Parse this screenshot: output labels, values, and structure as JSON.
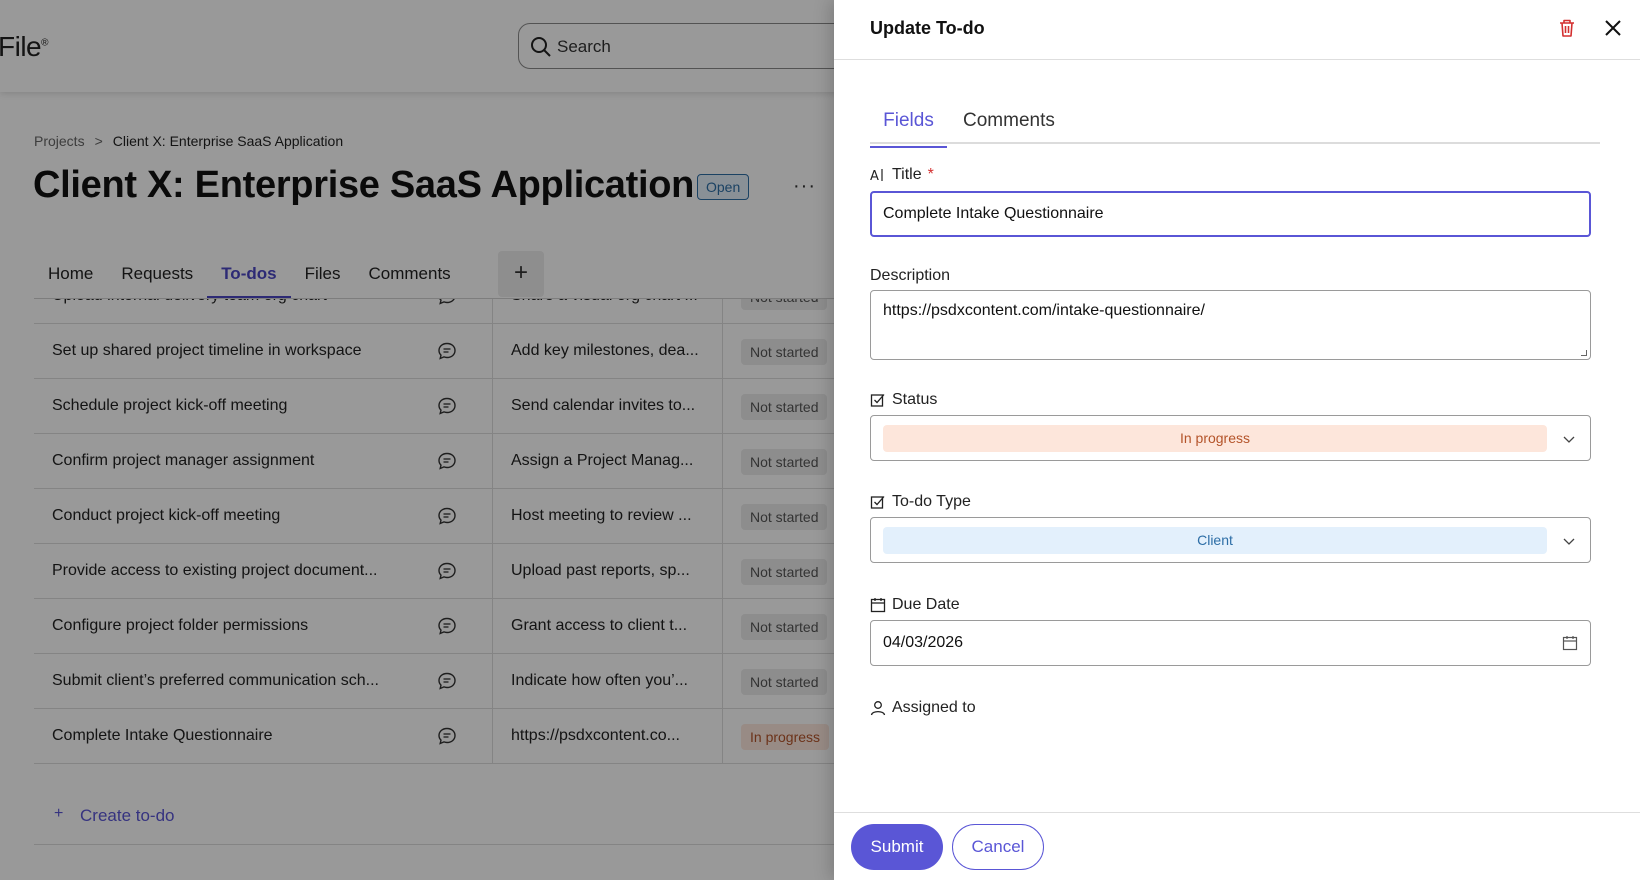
{
  "app": {
    "logo_text": "File",
    "logo_mark": "®"
  },
  "search": {
    "placeholder": "Search"
  },
  "breadcrumb": {
    "parent": "Projects",
    "separator": ">",
    "current": "Client X: Enterprise SaaS Application"
  },
  "project": {
    "title": "Client X: Enterprise SaaS Application",
    "status": "Open",
    "more": "···"
  },
  "tabs": [
    "Home",
    "Requests",
    "To-dos",
    "Files",
    "Comments"
  ],
  "tabs_active_index": 2,
  "add_tab": "+",
  "todos": [
    {
      "title": "Upload internal delivery team org chart",
      "description": "Share a visual org chart ...",
      "status": "Not started"
    },
    {
      "title": "Set up shared project timeline in workspace",
      "description": "Add key milestones, dea...",
      "status": "Not started"
    },
    {
      "title": "Schedule project kick-off meeting",
      "description": "Send calendar invites to...",
      "status": "Not started"
    },
    {
      "title": "Confirm project manager assignment",
      "description": "Assign a Project Manag...",
      "status": "Not started"
    },
    {
      "title": "Conduct project kick-off meeting",
      "description": "Host meeting to review ...",
      "status": "Not started"
    },
    {
      "title": "Provide access to existing project document...",
      "description": "Upload past reports, sp...",
      "status": "Not started"
    },
    {
      "title": "Configure project folder permissions",
      "description": "Grant access to client t...",
      "status": "Not started"
    },
    {
      "title": "Submit client’s preferred communication sch...",
      "description": "Indicate how often you’...",
      "status": "Not started"
    },
    {
      "title": "Complete Intake Questionnaire",
      "description": "https://psdxcontent.co...",
      "status": "In progress"
    }
  ],
  "create_todo": {
    "plus": "+",
    "label": "Create to-do"
  },
  "panel": {
    "title": "Update To-do",
    "tabs": [
      "Fields",
      "Comments"
    ],
    "fields": {
      "title_label": "Title",
      "required_mark": "*",
      "title_value": "Complete Intake Questionnaire",
      "description_label": "Description",
      "description_value": "https://psdxcontent.com/intake-questionnaire/",
      "status_label": "Status",
      "status_value": "In progress",
      "type_label": "To-do Type",
      "type_value": "Client",
      "due_label": "Due Date",
      "due_value": "04/03/2026",
      "assigned_label": "Assigned to"
    },
    "submit": "Submit",
    "cancel": "Cancel"
  },
  "colors": {
    "accent": "#5a56d6",
    "danger": "#d32f2f",
    "progress_bg": "#fde6db",
    "progress_fg": "#b4542a",
    "client_bg": "#e3f0fc",
    "client_fg": "#2d6ea6"
  },
  "icons": {
    "search": "search-icon",
    "comment": "comment-icon",
    "trash": "trash-icon",
    "close": "close-icon",
    "chevron": "chevron-down-icon",
    "calendar": "calendar-icon",
    "user": "user-icon",
    "checkbox": "checkbox-icon",
    "text": "text-field-icon"
  }
}
